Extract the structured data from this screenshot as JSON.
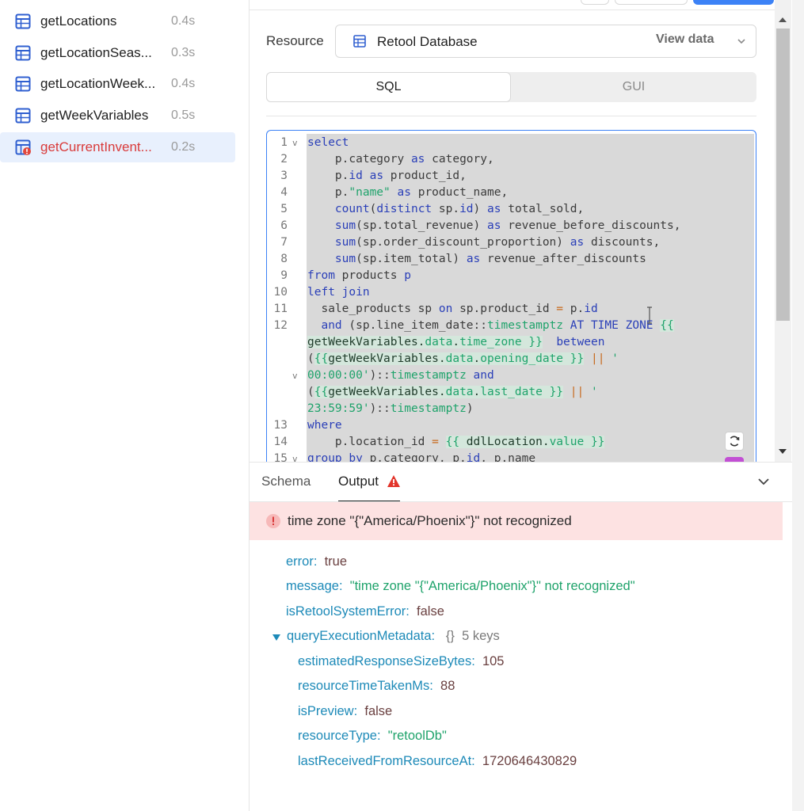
{
  "queries": [
    {
      "name": "getLocations",
      "time": "0.4s",
      "state": "normal"
    },
    {
      "name": "getLocationSeas...",
      "time": "0.3s",
      "state": "normal"
    },
    {
      "name": "getLocationWeek...",
      "time": "0.4s",
      "state": "normal"
    },
    {
      "name": "getWeekVariables",
      "time": "0.5s",
      "state": "normal"
    },
    {
      "name": "getCurrentInvent...",
      "time": "0.2s",
      "state": "error"
    }
  ],
  "resource": {
    "label": "Resource",
    "selected": "Retool Database",
    "view_data": "View data"
  },
  "mode": {
    "sql": "SQL",
    "gui": "GUI"
  },
  "code": {
    "line_numbers": [
      "1",
      "2",
      "3",
      "4",
      "5",
      "6",
      "7",
      "8",
      "9",
      "10",
      "11",
      "12",
      "13",
      "14",
      "15"
    ]
  },
  "output": {
    "tab_schema": "Schema",
    "tab_output": "Output",
    "error_message": "time zone \"{\"America/Phoenix\"}\" not recognized",
    "fields": {
      "error_key": "error:",
      "error_val": "true",
      "message_key": "message:",
      "message_val": "\"time zone \"{\"America/Phoenix\"}\" not recognized\"",
      "system_key": "isRetoolSystemError:",
      "system_val": "false",
      "meta_key": "queryExecutionMetadata:",
      "meta_braces": "{}",
      "meta_count": "5 keys",
      "size_key": "estimatedResponseSizeBytes:",
      "size_val": "105",
      "time_key": "resourceTimeTakenMs:",
      "time_val": "88",
      "preview_key": "isPreview:",
      "preview_val": "false",
      "type_key": "resourceType:",
      "type_val": "\"retoolDb\"",
      "last_key": "lastReceivedFromResourceAt:",
      "last_val": "1720646430829"
    }
  },
  "colors": {
    "accent": "#3c82f6",
    "error": "#d93b3b",
    "error_bg": "#fde2e2",
    "key": "#1d8ab8",
    "string": "#1fa36b"
  }
}
